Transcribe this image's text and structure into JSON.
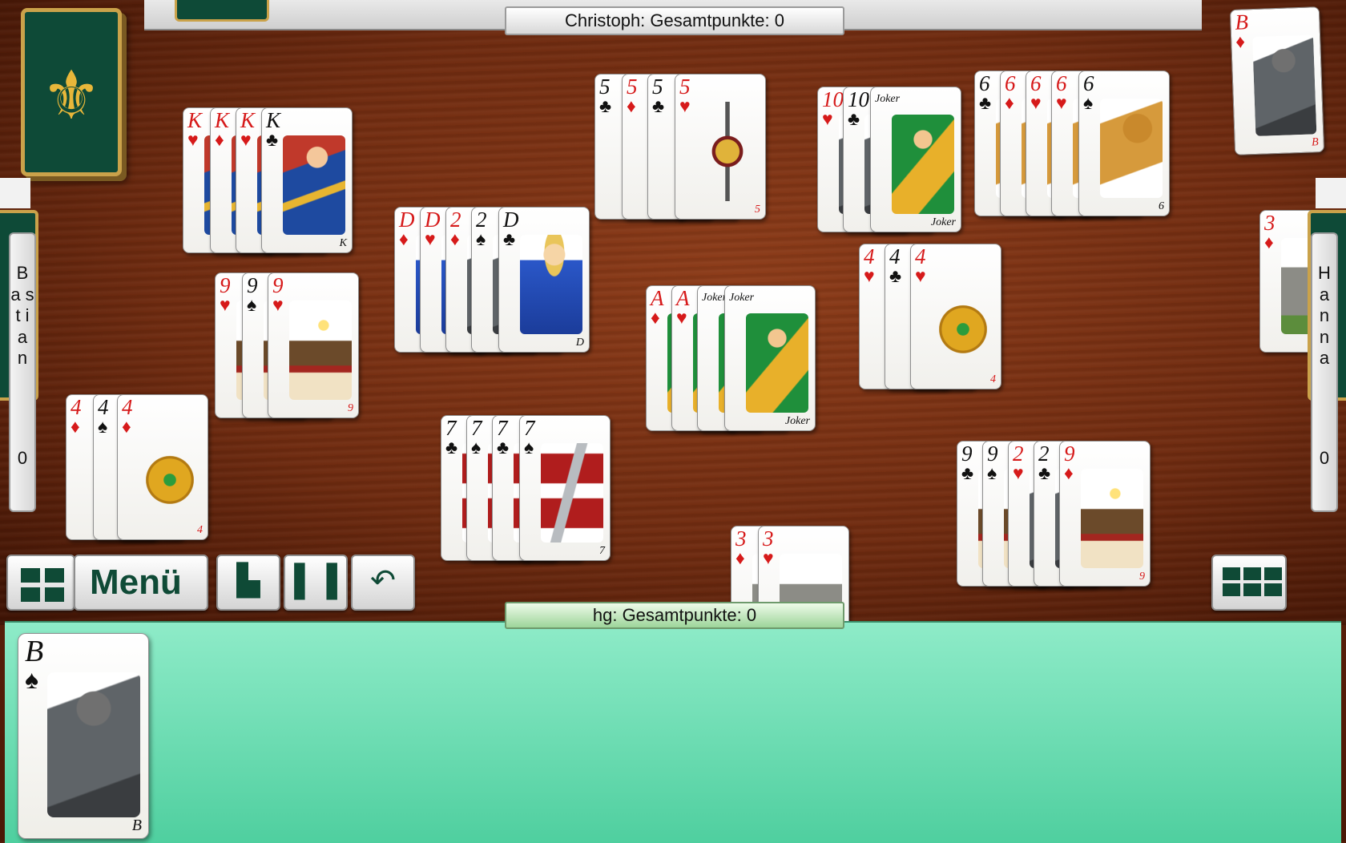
{
  "top_score": "Christoph: Gesamtpunkte: 0",
  "bottom_score": "hg: Gesamtpunkte: 0",
  "left_player": {
    "name": "B a s t i a n",
    "points": "0"
  },
  "right_player": {
    "name": "H a n n a",
    "points": "0"
  },
  "menu_label": "Menü",
  "hand_card": {
    "rank": "B",
    "suit": "♠",
    "bottom": "B"
  },
  "top_right_card": {
    "rank": "B",
    "suit": "♦",
    "bottom": "B"
  },
  "right_edge_card": {
    "rank": "3",
    "suit": "♦"
  }
}
